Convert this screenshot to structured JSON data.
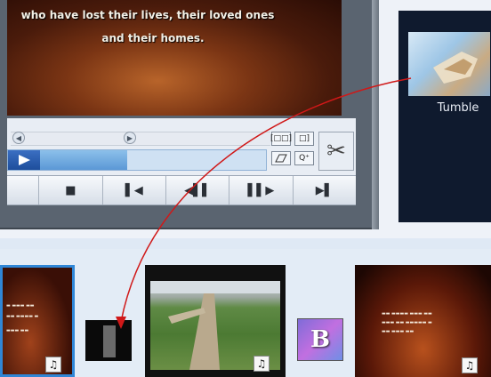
{
  "video": {
    "subtitle_line1": "who have lost their lives, their loved ones",
    "subtitle_line2": "and their homes."
  },
  "tools": {
    "scroll_left": "◀",
    "scroll_right": "▶",
    "split_icon": "[□□]",
    "join_icon": "□]",
    "zoom_icon": "Q⁺"
  },
  "transport": {
    "play": "▶",
    "stop": "■",
    "prev": "▌◀",
    "rewind": "◀▌▌",
    "forward": "▌▌▶",
    "next": "▶▌"
  },
  "preview": {
    "title": "Tumble"
  },
  "storyboard": {
    "music_icon": "♫",
    "transition_b_label": "B"
  },
  "colors": {
    "accent_blue": "#2b64c0",
    "arrow_red": "#d01818"
  }
}
